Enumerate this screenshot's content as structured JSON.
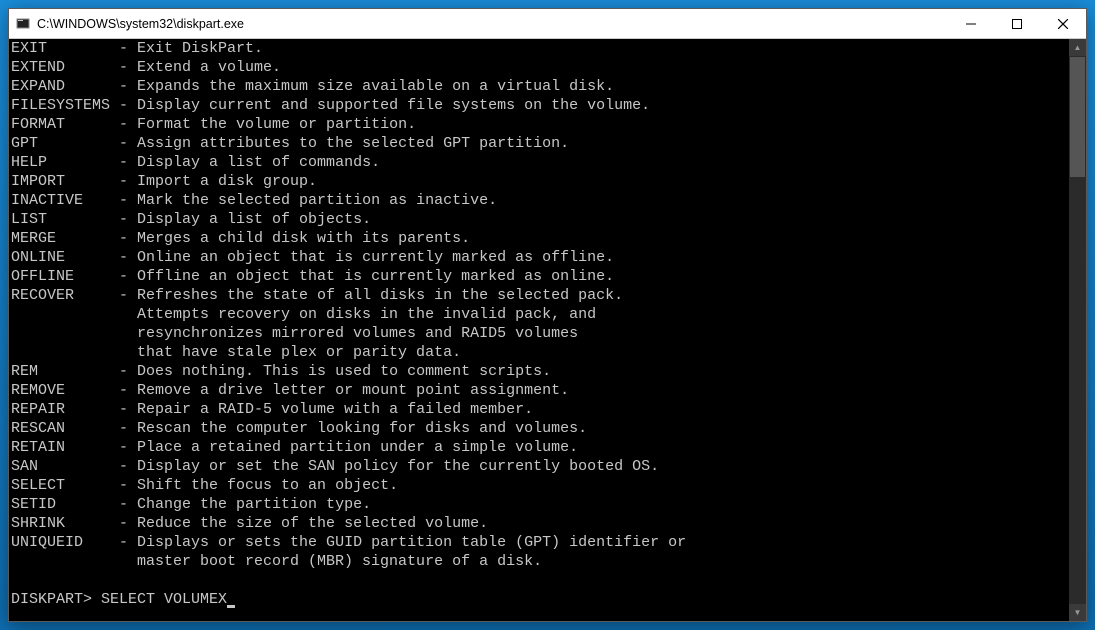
{
  "window": {
    "title": "C:\\WINDOWS\\system32\\diskpart.exe"
  },
  "commands": [
    {
      "name": "EXIT",
      "desc": "Exit DiskPart."
    },
    {
      "name": "EXTEND",
      "desc": "Extend a volume."
    },
    {
      "name": "EXPAND",
      "desc": "Expands the maximum size available on a virtual disk."
    },
    {
      "name": "FILESYSTEMS",
      "desc": "Display current and supported file systems on the volume."
    },
    {
      "name": "FORMAT",
      "desc": "Format the volume or partition."
    },
    {
      "name": "GPT",
      "desc": "Assign attributes to the selected GPT partition."
    },
    {
      "name": "HELP",
      "desc": "Display a list of commands."
    },
    {
      "name": "IMPORT",
      "desc": "Import a disk group."
    },
    {
      "name": "INACTIVE",
      "desc": "Mark the selected partition as inactive."
    },
    {
      "name": "LIST",
      "desc": "Display a list of objects."
    },
    {
      "name": "MERGE",
      "desc": "Merges a child disk with its parents."
    },
    {
      "name": "ONLINE",
      "desc": "Online an object that is currently marked as offline."
    },
    {
      "name": "OFFLINE",
      "desc": "Offline an object that is currently marked as online."
    },
    {
      "name": "RECOVER",
      "desc": "Refreshes the state of all disks in the selected pack.",
      "cont": [
        "Attempts recovery on disks in the invalid pack, and",
        "resynchronizes mirrored volumes and RAID5 volumes",
        "that have stale plex or parity data."
      ]
    },
    {
      "name": "REM",
      "desc": "Does nothing. This is used to comment scripts."
    },
    {
      "name": "REMOVE",
      "desc": "Remove a drive letter or mount point assignment."
    },
    {
      "name": "REPAIR",
      "desc": "Repair a RAID-5 volume with a failed member."
    },
    {
      "name": "RESCAN",
      "desc": "Rescan the computer looking for disks and volumes."
    },
    {
      "name": "RETAIN",
      "desc": "Place a retained partition under a simple volume."
    },
    {
      "name": "SAN",
      "desc": "Display or set the SAN policy for the currently booted OS."
    },
    {
      "name": "SELECT",
      "desc": "Shift the focus to an object."
    },
    {
      "name": "SETID",
      "desc": "Change the partition type."
    },
    {
      "name": "SHRINK",
      "desc": "Reduce the size of the selected volume."
    },
    {
      "name": "UNIQUEID",
      "desc": "Displays or sets the GUID partition table (GPT) identifier or",
      "cont": [
        "master boot record (MBR) signature of a disk."
      ]
    }
  ],
  "prompt": {
    "label": "DISKPART> ",
    "input": "SELECT VOLUMEX"
  }
}
